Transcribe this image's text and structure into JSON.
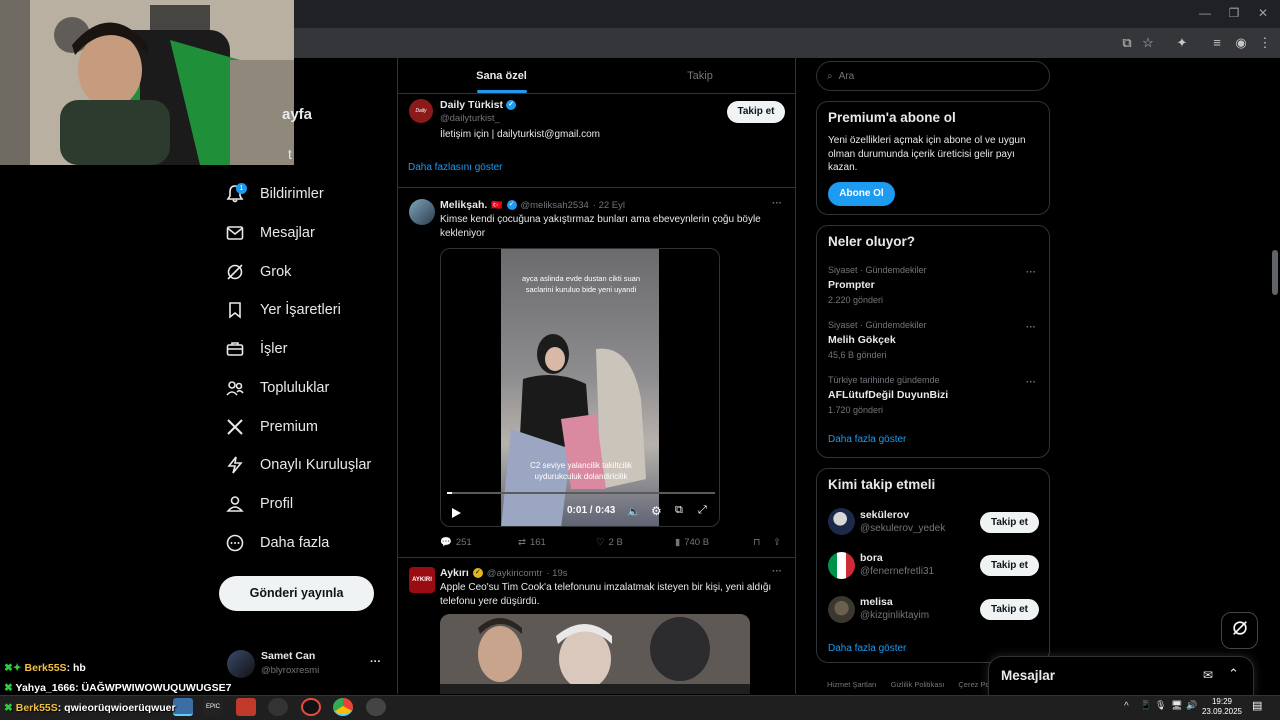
{
  "browser": {
    "window_controls": [
      "—",
      "❐",
      "✕"
    ],
    "toolbar_icons": [
      "install-icon",
      "star-icon",
      "extensions-icon",
      "media-icon",
      "profile-icon",
      "menu-icon"
    ]
  },
  "nav": {
    "partial_top": "ayfa",
    "partial_second": "t",
    "notif_badge": "1",
    "items": [
      {
        "label": "Bildirimler",
        "icon": "bell-icon"
      },
      {
        "label": "Mesajlar",
        "icon": "mail-icon"
      },
      {
        "label": "Grok",
        "icon": "grok-icon"
      },
      {
        "label": "Yer İşaretleri",
        "icon": "bookmark-icon"
      },
      {
        "label": "İşler",
        "icon": "briefcase-icon"
      },
      {
        "label": "Topluluklar",
        "icon": "people-icon"
      },
      {
        "label": "Premium",
        "icon": "x-logo-icon"
      },
      {
        "label": "Onaylı Kuruluşlar",
        "icon": "lightning-icon"
      },
      {
        "label": "Profil",
        "icon": "person-icon"
      },
      {
        "label": "Daha fazla",
        "icon": "more-circle-icon"
      }
    ],
    "post_button": "Gönderi yayınla",
    "account": {
      "name": "Samet Can",
      "handle": "@blyroxresmi",
      "more": "···"
    }
  },
  "tabs": {
    "for_you": "Sana özel",
    "following": "Takip"
  },
  "suggested": {
    "name": "Daily Türkist",
    "handle": "@dailyturkist_",
    "bio": "İletişim için | dailyturkist@gmail.com",
    "follow": "Takip et",
    "avatar_text": "Daily Türkist",
    "show_more": "Daha fazlasını göster"
  },
  "tweet1": {
    "name": "Melikşah.",
    "flag": "🇹🇷",
    "handle": "@meliksah2534",
    "date": "· 22 Eyl",
    "more": "···",
    "text": "Kimse kendi çocuğuna yakıştırmaz bunları ama ebeveynlerin çoğu böyle kekleniyor",
    "video": {
      "caption_top": "ayca aslinda evde dustan cikti suan saclarini kuruluo bide yeni uyandi",
      "caption_bottom": "C2 seviye yalancilik takiltcilik uydurukculuk dolandiricilik",
      "time": "0:01 / 0:43",
      "progress": 0.02
    },
    "stats": {
      "replies": "251",
      "reposts": "161",
      "likes": "2 B",
      "views": "740 B"
    }
  },
  "tweet2": {
    "name": "Aykırı",
    "handle": "@aykiricomtr",
    "date": "· 19s",
    "more": "···",
    "avatar_text": "AYKIRI",
    "text": "Apple Ceo'su Tim Cook'a telefonunu imzalatmak isteyen bir kişi, yeni aldığı telefonu yere düşürdü."
  },
  "sidebar": {
    "search_placeholder": "Ara",
    "premium": {
      "title": "Premium'a abone ol",
      "body": "Yeni özellikleri açmak için abone ol ve uygun olman durumunda içerik üreticisi gelir payı kazan.",
      "button": "Abone Ol"
    },
    "trends": {
      "title": "Neler oluyor?",
      "items": [
        {
          "category": "Siyaset · Gündemdekiler",
          "name": "Prompter",
          "count": "2.220 gönderi"
        },
        {
          "category": "Siyaset · Gündemdekiler",
          "name": "Melih Gökçek",
          "count": "45,6 B gönderi"
        },
        {
          "category": "Türkiye tarihinde gündemde",
          "name": "AFLütufDeğil DuyunBizi",
          "count": "1.720 gönderi"
        }
      ],
      "more": "···",
      "show_more": "Daha fazla göster"
    },
    "who_to_follow": {
      "title": "Kimi takip etmeli",
      "items": [
        {
          "name": "sekülerov",
          "handle": "@sekulerov_yedek",
          "follow": "Takip et"
        },
        {
          "name": "bora",
          "handle": "@fenernefretli31",
          "follow": "Takip et"
        },
        {
          "name": "melisa",
          "handle": "@kizginliktayim",
          "follow": "Takip et"
        }
      ],
      "show_more": "Daha fazla göster"
    },
    "footer": [
      "Hizmet Şartları",
      "Gizlilik Politikası",
      "Çerez Po"
    ]
  },
  "messages_drawer": {
    "title": "Mesajlar"
  },
  "chat_overlay": [
    {
      "user": "Berk55S",
      "text": ": hb",
      "color": "#f0c040"
    },
    {
      "user": "Yahya_1666",
      "text": ": ÜAĞWPWIWOWUQUWUGSE7",
      "color": "#ffffff"
    },
    {
      "user": "Berk55S",
      "text": ": qwieorüqwioerüqwuer",
      "color": "#f0c040"
    }
  ],
  "taskbar": {
    "time": "19:29",
    "date": "23.09.2025",
    "tray": [
      "^",
      "📱",
      "🎙",
      "🖥",
      "🔊"
    ]
  }
}
